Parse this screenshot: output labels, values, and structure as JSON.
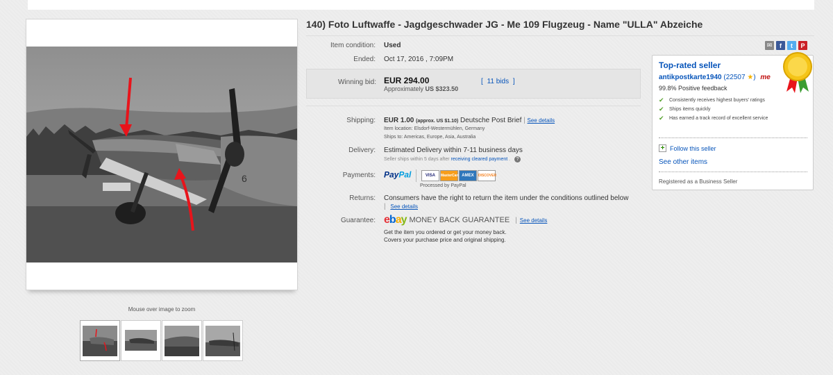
{
  "title": "140) Foto Luftwaffe - Jagdgeschwader JG - Me 109 Flugzeug - Name \"ULLA\" Abzeiche",
  "gallery": {
    "zoom_hint": "Mouse over image to zoom",
    "thumbnail_count": 4
  },
  "details": {
    "condition_label": "Item condition:",
    "condition_value": "Used",
    "ended_label": "Ended:",
    "ended_value": "Oct 17, 2016 , 7:09PM",
    "winning_bid_label": "Winning bid:",
    "winning_bid_value": "EUR 294.00",
    "approx_prefix": "Approximately",
    "approx_value": "US $323.50",
    "bids_open": "[",
    "bids_link": "11 bids",
    "bids_close": "]"
  },
  "shipping": {
    "label": "Shipping:",
    "price": "EUR 1.00",
    "approx": "(approx. US $1.10)",
    "service": "Deutsche Post Brief",
    "divider": "|",
    "see_details": "See details",
    "location_label": "Item location:",
    "location_value": "Elsdorf-Westermühlen, Germany",
    "ships_to_label": "Ships to:",
    "ships_to_value": "Americas, Europe, Asia, Australia"
  },
  "delivery": {
    "label": "Delivery:",
    "value": "Estimated Delivery within 7-11 business days",
    "note_prefix": "Seller ships within 5 days after",
    "note_link": "receiving cleared payment",
    "note_suffix": ".",
    "help_icon": "?"
  },
  "payments": {
    "label": "Payments:",
    "paypal_pay": "Pay",
    "paypal_pal": "Pal",
    "cards": [
      "VISA",
      "MasterCard",
      "AMEX",
      "DISCOVER"
    ],
    "processed_by": "Processed by PayPal"
  },
  "returns": {
    "label": "Returns:",
    "value": "Consumers have the right to return the item under the conditions outlined below",
    "divider": "|",
    "see_details": "See details"
  },
  "guarantee": {
    "label": "Guarantee:",
    "logo_letters": [
      "e",
      "b",
      "a",
      "y"
    ],
    "logo_colors": [
      "#e53238",
      "#0064d2",
      "#f5af02",
      "#86b817"
    ],
    "text": "MONEY BACK GUARANTEE",
    "divider": "|",
    "see_details": "See details",
    "line1": "Get the item you ordered or get your money back.",
    "line2": "Covers your purchase price and original shipping."
  },
  "seller": {
    "badge_title": "Top-rated seller",
    "name": "antikpostkarte1940",
    "score": "(22507",
    "score_close": ")",
    "me_badge": "me",
    "feedback": "99.8% Positive feedback",
    "points": [
      "Consistently receives highest buyers' ratings",
      "Ships items quickly",
      "Has earned a track record of excellent service"
    ],
    "follow": "Follow this seller",
    "other_items": "See other items",
    "registered": "Registered as a Business Seller"
  },
  "colors": {
    "link": "#0654ba",
    "check": "#57a22e",
    "arrow": "#e8141b"
  }
}
